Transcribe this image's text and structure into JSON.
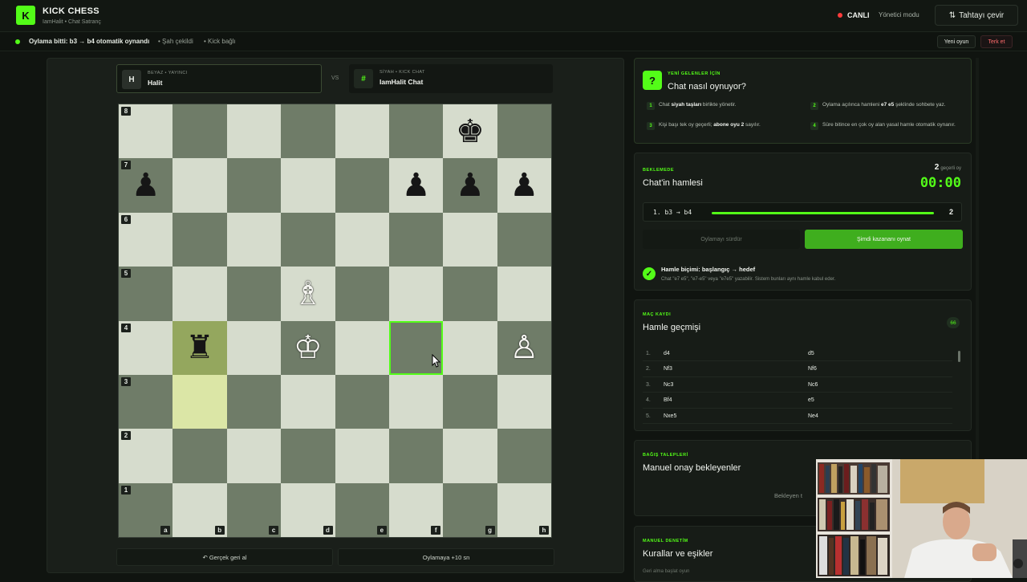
{
  "header": {
    "logo_letter": "K",
    "title": "KICK CHESS",
    "subtitle": "IamHalit • Chat Satranç",
    "live_label": "CANLI",
    "mode_label": "Yönetici modu",
    "flip_label": "Tahtayı çevir",
    "flip_icon": "swap-vertical-icon"
  },
  "status": {
    "main": "Oylama bitti: b3 → b4 otomatik oynandı",
    "item1": "Şah çekildi",
    "item2": "Kick bağlı",
    "new_game": "Yeni oyun",
    "resign": "Terk et"
  },
  "players": {
    "white": {
      "avatar": "H",
      "role": "BEYAZ • YAYINCI",
      "name": "Halit"
    },
    "vs": "VS",
    "black": {
      "avatar": "#",
      "role": "SİYAH • KICK CHAT",
      "name": "IamHalit Chat"
    }
  },
  "board": {
    "ranks": [
      "8",
      "7",
      "6",
      "5",
      "4",
      "3",
      "2",
      "1"
    ],
    "files": [
      "a",
      "b",
      "c",
      "d",
      "e",
      "f",
      "g",
      "h"
    ],
    "pieces": {
      "g8": {
        "glyph": "♚",
        "color": "black",
        "name": "black-king"
      },
      "a7": {
        "glyph": "♟",
        "color": "black",
        "name": "black-pawn"
      },
      "f7": {
        "glyph": "♟",
        "color": "black",
        "name": "black-pawn"
      },
      "g7": {
        "glyph": "♟",
        "color": "black",
        "name": "black-pawn"
      },
      "h7": {
        "glyph": "♟",
        "color": "black",
        "name": "black-pawn"
      },
      "d5": {
        "glyph": "♗",
        "color": "white",
        "name": "white-bishop"
      },
      "b4": {
        "glyph": "♜",
        "color": "black",
        "name": "black-rook"
      },
      "d4": {
        "glyph": "♔",
        "color": "white",
        "name": "white-king"
      },
      "h4": {
        "glyph": "♙",
        "color": "white",
        "name": "white-pawn"
      }
    },
    "last_move": [
      "b3",
      "b4"
    ],
    "selected": "f4",
    "colors": {
      "light": "#d6dccd",
      "dark": "#6f7c68",
      "accent": "#53fc18"
    }
  },
  "bottom": {
    "undo": "↶ Gerçek geri al",
    "extend": "Oylamaya +10 sn"
  },
  "how": {
    "eyebrow": "YENİ GELENLER İÇİN",
    "title": "Chat nasıl oynuyor?",
    "rules": [
      {
        "n": "1",
        "pre": "Chat ",
        "bold": "siyah taşları",
        "post": " birlikte yönetir."
      },
      {
        "n": "2",
        "pre": "Oylama açılınca hamleni ",
        "bold": "e7 e5",
        "post": " şeklinde sohbete yaz."
      },
      {
        "n": "3",
        "pre": "Kişi başı tek oy geçerli; ",
        "bold": "abone oyu 2",
        "post": " sayılır."
      },
      {
        "n": "4",
        "pre": "Süre bitince en çok oy alan yasal hamle otomatik oynanır.",
        "bold": "",
        "post": ""
      }
    ]
  },
  "waiting": {
    "eyebrow": "BEKLEMEDE",
    "title": "Chat'in hamlesi",
    "vote_count": "2",
    "vote_count_label": "geçerli oy",
    "timer": "00:00",
    "vote_move": "1. b3 → b4",
    "vote_n": "2",
    "vote_share": 1.0,
    "continue_label": "Oylamayı sürdür",
    "play_label": "Şimdi kazananı oynat",
    "format_title": "Hamle biçimi: başlangıç → hedef",
    "format_sub": "Chat \"e7 e5\", \"e7-e5\" veya \"e7e5\" yazabilir. Sistem bunları aynı hamle kabul eder."
  },
  "history": {
    "eyebrow": "MAÇ KAYDI",
    "title": "Hamle geçmişi",
    "count": "66",
    "rows": [
      {
        "n": "1.",
        "w": "d4",
        "b": "d5"
      },
      {
        "n": "2.",
        "w": "Nf3",
        "b": "Nf6"
      },
      {
        "n": "3.",
        "w": "Nc3",
        "b": "Nc6"
      },
      {
        "n": "4.",
        "w": "Bf4",
        "b": "e5"
      },
      {
        "n": "5.",
        "w": "Nxe5",
        "b": "Ne4"
      }
    ]
  },
  "donations": {
    "eyebrow": "BAĞIŞ TALEPLERİ",
    "title": "Manuel onay bekleyenler",
    "pending": "Bekleyen t"
  },
  "moderation": {
    "eyebrow": "MANUEL DENETİM",
    "title": "Kurallar ve eşikler",
    "sub": "Geri alma başlat oyun"
  }
}
